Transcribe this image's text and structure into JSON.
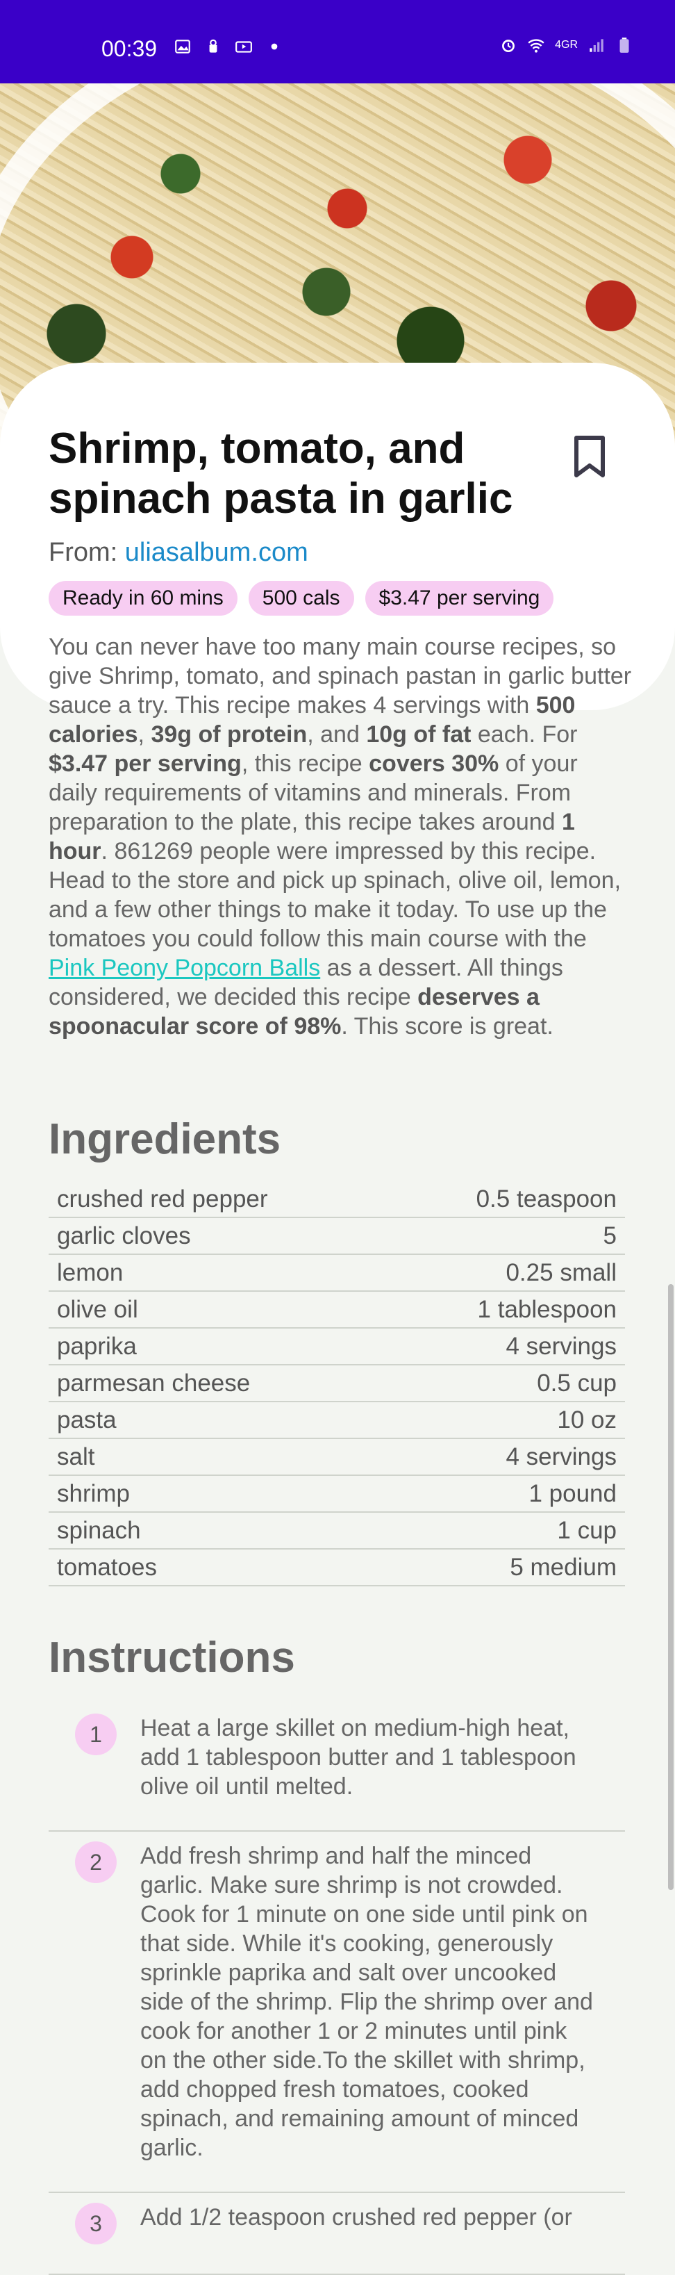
{
  "status_bar": {
    "time": "00:39",
    "network": "4GR",
    "icons_left": [
      "image-icon",
      "android-icon",
      "media-icon",
      "dot-icon"
    ],
    "icons_right": [
      "alarm-icon",
      "wifi-icon",
      "signal-icon",
      "battery-icon"
    ],
    "bg_color": "#3a00c8"
  },
  "recipe": {
    "title": "Shrimp, tomato, and spinach pasta in garlic",
    "source_prefix": "From:",
    "source_name": "uliasalbum.com",
    "tags": [
      "Ready in 60 mins",
      "500 cals",
      "$3.47 per serving"
    ],
    "summary": {
      "p1": "You can never have too many main course recipes, so give Shrimp, tomato, and spinach pastan in garlic butter sauce a try. This recipe makes 4 servings with ",
      "b1": "500 calories",
      "p2": ", ",
      "b2": "39g of protein",
      "p3": ", and ",
      "b3": "10g of fat",
      "p4": " each. For ",
      "b4": "$3.47 per serving",
      "p5": ", this recipe ",
      "b5": "covers 30%",
      "p6": " of your daily requirements of vitamins and minerals. From preparation to the plate, this recipe takes around ",
      "b6": "1 hour",
      "p7": ". 861269 people were impressed by this recipe. Head to the store and pick up spinach, olive oil, lemon, and a few other things to make it today. To use up the tomatoes you could follow this main course with the ",
      "link": "Pink Peony Popcorn Balls",
      "p8": " as a dessert. All things considered, we decided this recipe ",
      "b7": "deserves a spoonacular score of 98%",
      "p9": ". This score is great."
    }
  },
  "ingredients": {
    "heading": "Ingredients",
    "items": [
      {
        "name": "crushed red pepper",
        "amount": "0.5 teaspoon"
      },
      {
        "name": "garlic cloves",
        "amount": "5"
      },
      {
        "name": "lemon",
        "amount": "0.25 small"
      },
      {
        "name": "olive oil",
        "amount": "1 tablespoon"
      },
      {
        "name": "paprika",
        "amount": "4 servings"
      },
      {
        "name": "parmesan cheese",
        "amount": "0.5 cup"
      },
      {
        "name": "pasta",
        "amount": "10 oz"
      },
      {
        "name": "salt",
        "amount": "4 servings"
      },
      {
        "name": "shrimp",
        "amount": "1 pound"
      },
      {
        "name": "spinach",
        "amount": "1 cup"
      },
      {
        "name": "tomatoes",
        "amount": "5 medium"
      }
    ]
  },
  "instructions": {
    "heading": "Instructions",
    "steps": [
      {
        "num": "1",
        "text": "Heat a large skillet on medium-high heat, add 1 tablespoon butter and 1 tablespoon olive oil until melted."
      },
      {
        "num": "2",
        "text": "Add fresh shrimp and half the minced garlic. Make sure shrimp is not crowded. Cook for 1 minute on one side until pink on that side. While it's cooking, generously sprinkle paprika and salt over uncooked side of the shrimp. Flip the shrimp over and cook for another 1 or 2 minutes until pink on the other side.To the skillet with shrimp, add chopped fresh tomatoes, cooked spinach, and remaining amount of minced garlic."
      },
      {
        "num": "3",
        "text": "Add 1/2 teaspoon crushed red pepper (or"
      }
    ]
  },
  "colors": {
    "accent_tag": "#f7cdf2",
    "link": "#1b8ac9",
    "inline_link": "#1bc7c0",
    "background": "#f3f5f1"
  }
}
